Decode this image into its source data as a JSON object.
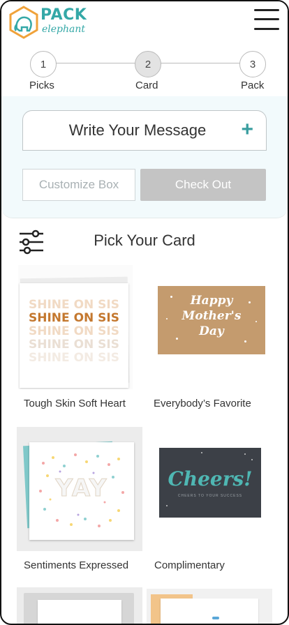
{
  "brand": {
    "title": "PACK",
    "subtitle": "elephant"
  },
  "steps": [
    {
      "number": "1",
      "label": "Picks"
    },
    {
      "number": "2",
      "label": "Card"
    },
    {
      "number": "3",
      "label": "Pack"
    }
  ],
  "message": {
    "label": "Write Your Message",
    "plus": "+"
  },
  "actions": {
    "customize": "Customize Box",
    "checkout": "Check Out"
  },
  "pick": {
    "title": "Pick Your Card"
  },
  "cards": [
    {
      "name": "Tough Skin Soft Heart",
      "art": [
        "SHINE ON SIS",
        "SHINE ON SIS",
        "SHINE ON SIS",
        "SHINE ON SIS",
        "SHINE ON SIS"
      ]
    },
    {
      "name": "Everybody’s Favorite",
      "art": [
        "Happy",
        "Mother's",
        "Day"
      ]
    },
    {
      "name": "Sentiments Expressed",
      "art": [
        "YAY"
      ]
    },
    {
      "name": "Complimentary",
      "art": [
        "Cheers!",
        "CHEERS TO YOUR SUCCESS"
      ]
    }
  ],
  "colors": {
    "brand": "#34a8a7",
    "panel": "#f2fafc",
    "checkout": "#c4c4c4"
  }
}
